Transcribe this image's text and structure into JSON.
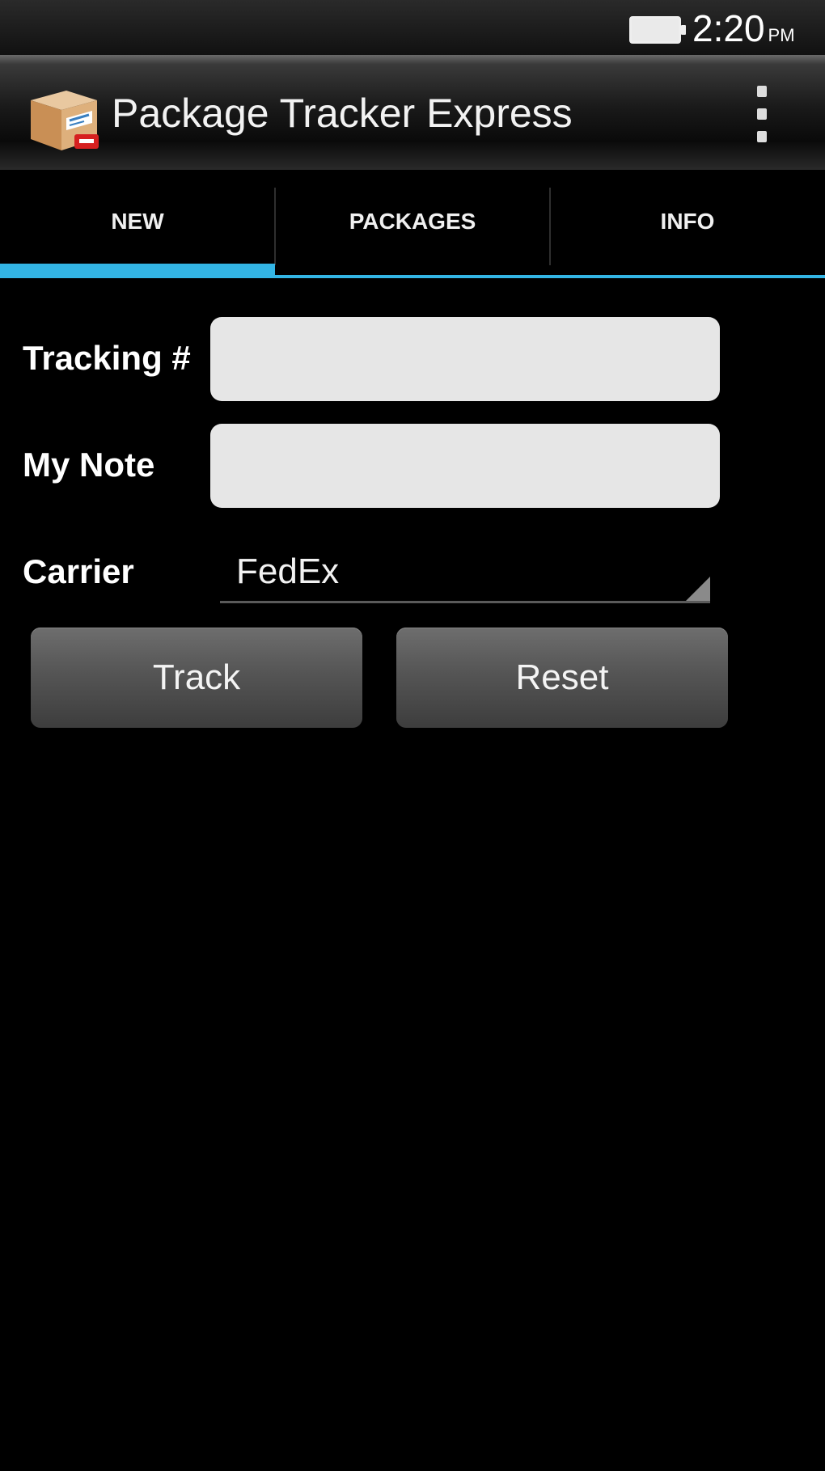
{
  "status_bar": {
    "time": "2:20",
    "ampm": "PM",
    "battery_icon": "battery-full-icon"
  },
  "action_bar": {
    "app_icon": "package-box-icon",
    "title": "Package Tracker Express",
    "overflow_icon": "overflow-menu-icon"
  },
  "tabs": [
    {
      "label": "NEW",
      "selected": true
    },
    {
      "label": "PACKAGES",
      "selected": false
    },
    {
      "label": "INFO",
      "selected": false
    }
  ],
  "form": {
    "tracking_label": "Tracking #",
    "tracking_value": "",
    "note_label": "My Note",
    "note_value": "",
    "carrier_label": "Carrier",
    "carrier_selected": "FedEx"
  },
  "buttons": {
    "track_label": "Track",
    "reset_label": "Reset"
  },
  "colors": {
    "accent": "#33b5e5",
    "background": "#000000",
    "input_background": "#e6e6e6"
  }
}
